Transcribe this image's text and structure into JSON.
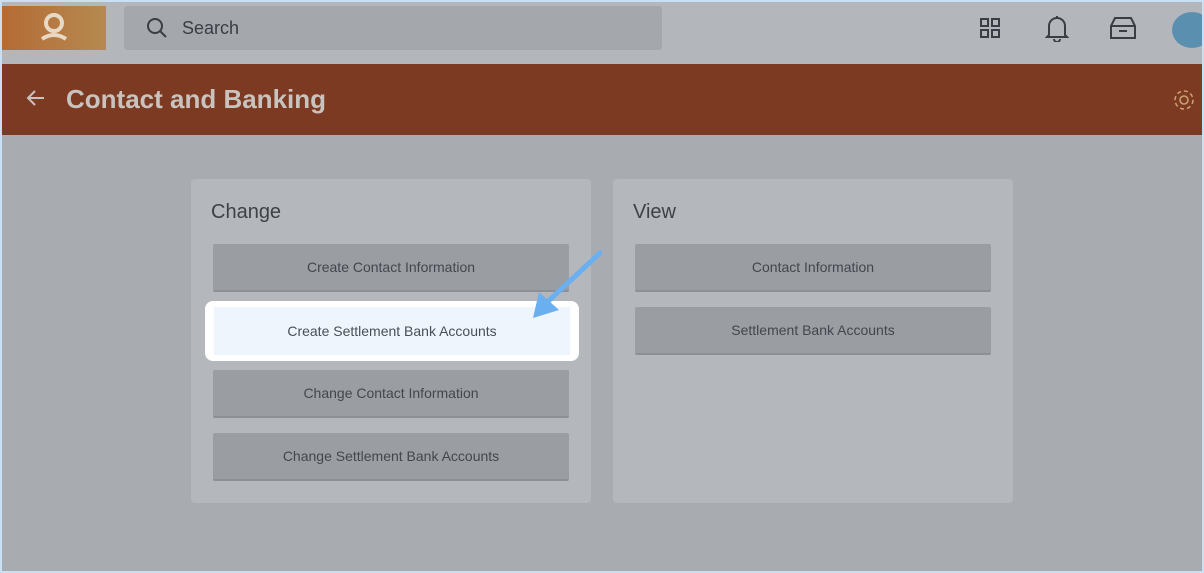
{
  "search": {
    "placeholder": "Search"
  },
  "header": {
    "title": "Contact and Banking"
  },
  "change": {
    "heading": "Change",
    "buttons": [
      "Create Contact Information",
      "Create Settlement Bank Accounts",
      "Change Contact Information",
      "Change Settlement Bank Accounts"
    ]
  },
  "view": {
    "heading": "View",
    "buttons": [
      "Contact Information",
      "Settlement Bank Accounts"
    ]
  },
  "colors": {
    "header": "#7c3a22",
    "highlight_arrow": "#6ab0f0"
  }
}
